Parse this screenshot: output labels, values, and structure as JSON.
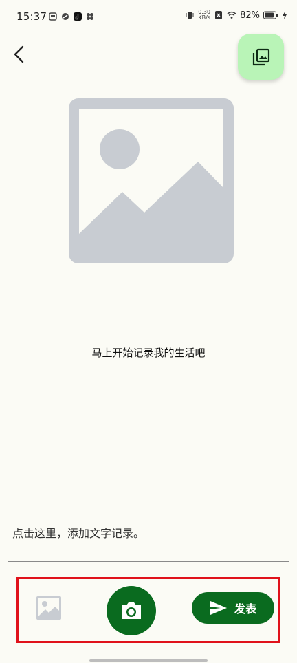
{
  "status_bar": {
    "time": "15:37",
    "net_speed_value": "0.30",
    "net_speed_unit": "KB/s",
    "battery": "82%"
  },
  "empty_state": {
    "hint": "马上开始记录我的生活吧"
  },
  "composer": {
    "placeholder": "点击这里，添加文字记录。"
  },
  "actions": {
    "publish_label": "发表"
  },
  "colors": {
    "primary": "#0a6b1f",
    "gallery_fab": "#b9f4b7",
    "placeholder_gray": "#c8ccd2",
    "highlight_box": "#e0121b"
  }
}
